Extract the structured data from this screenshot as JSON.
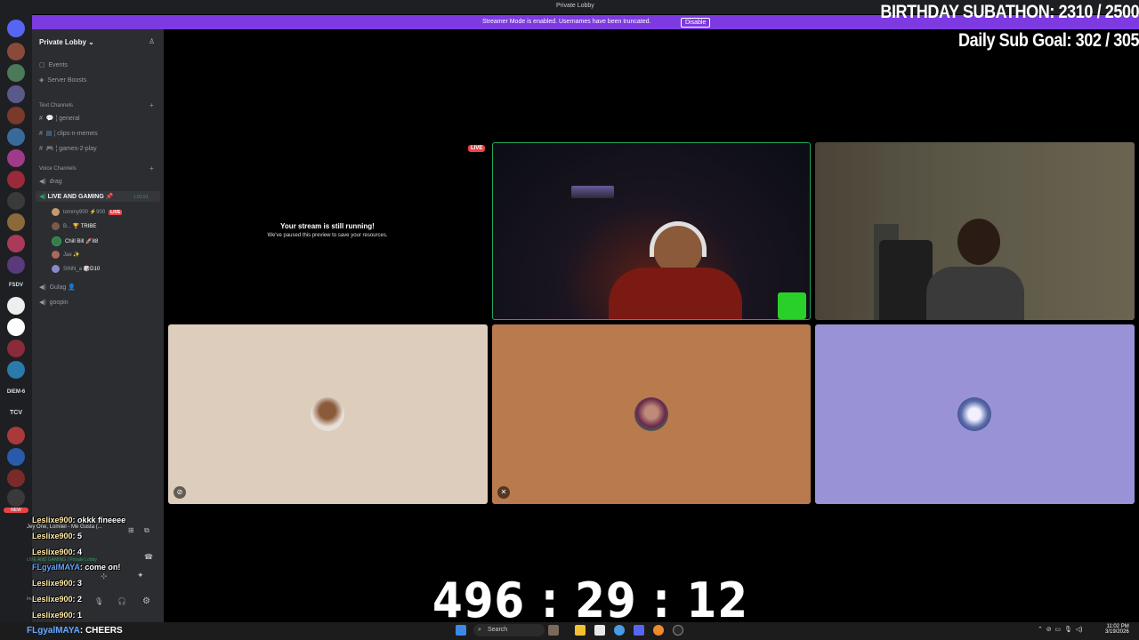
{
  "window": {
    "title": "Private Lobby"
  },
  "banner": {
    "text": "Streamer Mode is enabled. Usernames have been truncated.",
    "button": "Disable"
  },
  "guild_labels": [
    "FSDV",
    "DIEM-6",
    "TCV",
    "NEW"
  ],
  "server": {
    "name": "Private Lobby",
    "items": [
      {
        "label": "Events"
      },
      {
        "label": "Server Boosts"
      }
    ],
    "text_category": "Text Channels",
    "text_channels": [
      "general",
      "clips-n-memes",
      "games-2-play"
    ],
    "voice_category": "Voice Channels",
    "voice_channels": [
      "drag",
      "LIVE AND GAMING",
      "Gulag",
      "goopin"
    ],
    "active_timer": "1:01:51",
    "voice_users": [
      {
        "name": "tommy900",
        "tag": "900",
        "live": "LIVE"
      },
      {
        "name": "B...",
        "tag": "TRIBE"
      },
      {
        "name": "Chill Bill",
        "tag": "88"
      },
      {
        "name": "Jae",
        "tag": ""
      },
      {
        "name": "SINN_a",
        "tag": "D10"
      }
    ]
  },
  "user_panel": {
    "activity": "Jey One, Lomiiel - Me Gusta (...",
    "voice_status": "LIVE AND GAMING / Private Lobby",
    "status": "Invisible"
  },
  "chat_overlay": [
    {
      "name": "Leslixe900",
      "text": ": okkk fineeee"
    },
    {
      "name": "Leslixe900",
      "text": ": 5"
    },
    {
      "name": "Leslixe900",
      "text": ": 4"
    },
    {
      "name": "FLgyalMAYA",
      "text": ": come on!"
    },
    {
      "name": "Leslixe900",
      "text": ": 3"
    },
    {
      "name": "Leslixe900",
      "text": ": 2"
    },
    {
      "name": "Leslixe900",
      "text": ": 1"
    }
  ],
  "bottom_chat": {
    "name": "FLgyalMAYA",
    "text": ": CHEERS"
  },
  "stream": {
    "live_badge": "LIVE",
    "paused_title": "Your stream is still running!",
    "paused_sub": "We've paused this preview to save your resources."
  },
  "overlay": {
    "goal1": "BIRTHDAY SUBATHON:  2310 / 2500",
    "goal2": "Daily Sub Goal:  302 / 305",
    "timer": "496 : 29 : 12"
  },
  "taskbar": {
    "search": "Search",
    "time": "11:02 PM",
    "date": "3/19/2026"
  },
  "colors": {
    "accent": "#7c3ae0",
    "live": "#ed4245",
    "speaking": "#23a55a"
  }
}
